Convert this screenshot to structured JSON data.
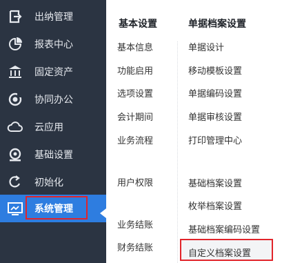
{
  "sidebar": {
    "items": [
      {
        "icon": "cashier-icon",
        "label": "出纳管理"
      },
      {
        "icon": "pie-chart-icon",
        "label": "报表中心"
      },
      {
        "icon": "bank-icon",
        "label": "固定资产"
      },
      {
        "icon": "collaboration-icon",
        "label": "协同办公"
      },
      {
        "icon": "cloud-icon",
        "label": "云应用"
      },
      {
        "icon": "settings-icon",
        "label": "基础设置"
      },
      {
        "icon": "refresh-icon",
        "label": "初始化"
      },
      {
        "icon": "monitor-icon",
        "label": "系统管理"
      }
    ],
    "active_index": 7
  },
  "panel": {
    "col1_title": "基本设置",
    "col2_title": "单据档案设置",
    "col1_items": [
      "基本信息",
      "功能启用",
      "选项设置",
      "会计期间",
      "业务流程",
      "用户权限",
      "业务结账",
      "财务结账"
    ],
    "col2_items": [
      "单据设计",
      "移动模板设置",
      "单据编码设置",
      "单据审核设置",
      "打印管理中心",
      "基础档案设置",
      "枚举档案设置",
      "基础档案编码设置",
      "自定义档案设置"
    ]
  },
  "colors": {
    "sidebar_bg": "#2b3442",
    "active_bg": "#2e7de0",
    "highlight_border": "#e1242a"
  }
}
